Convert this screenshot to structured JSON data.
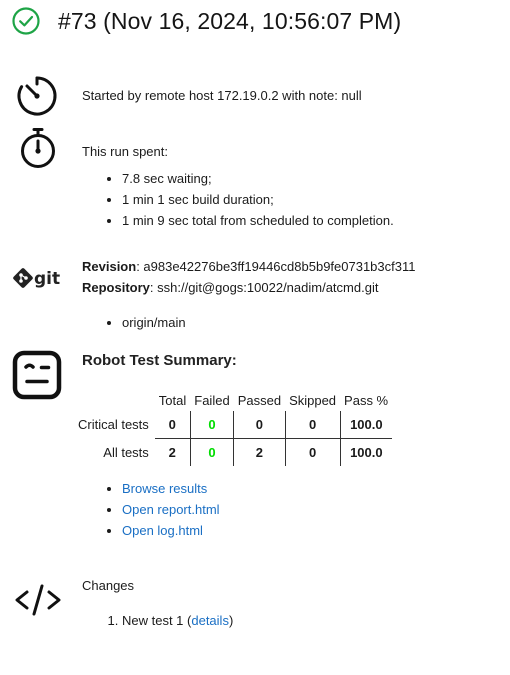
{
  "header": {
    "status_icon": "check-circle-icon",
    "status_color": "#1ea446",
    "title": "#73 (Nov 16, 2024, 10:56:07 PM)"
  },
  "cause": {
    "icon": "timer-icon",
    "text": "Started by remote host 172.19.0.2 with note: null"
  },
  "timing": {
    "icon": "stopwatch-icon",
    "heading": "This run spent:",
    "items": [
      "7.8 sec waiting;",
      "1 min 1 sec build duration;",
      "1 min 9 sec total from scheduled to completion."
    ]
  },
  "git": {
    "icon": "git-logo-icon",
    "logo_text": "git",
    "revision_label": "Revision",
    "revision_value": ": a983e42276be3ff19446cd8b5b9fe0731b3cf311",
    "repository_label": "Repository",
    "repository_value": ": ssh://git@gogs:10022/nadim/atcmd.git",
    "branches": [
      "origin/main"
    ]
  },
  "robot": {
    "icon": "robot-icon",
    "title": "Robot Test Summary:",
    "columns": [
      "Total",
      "Failed",
      "Passed",
      "Skipped",
      "Pass %"
    ],
    "rows": [
      {
        "label": "Critical tests",
        "values": [
          "0",
          "0",
          "0",
          "0",
          "100.0"
        ]
      },
      {
        "label": "All tests",
        "values": [
          "2",
          "0",
          "2",
          "0",
          "100.0"
        ]
      }
    ],
    "links": [
      "Browse results",
      "Open report.html",
      "Open log.html"
    ],
    "failed_color": "#00dd00"
  },
  "changes": {
    "icon": "code-brackets-icon",
    "heading": "Changes",
    "items": [
      {
        "text": "New test 1 (",
        "link": "details",
        "suffix": ")"
      }
    ]
  }
}
